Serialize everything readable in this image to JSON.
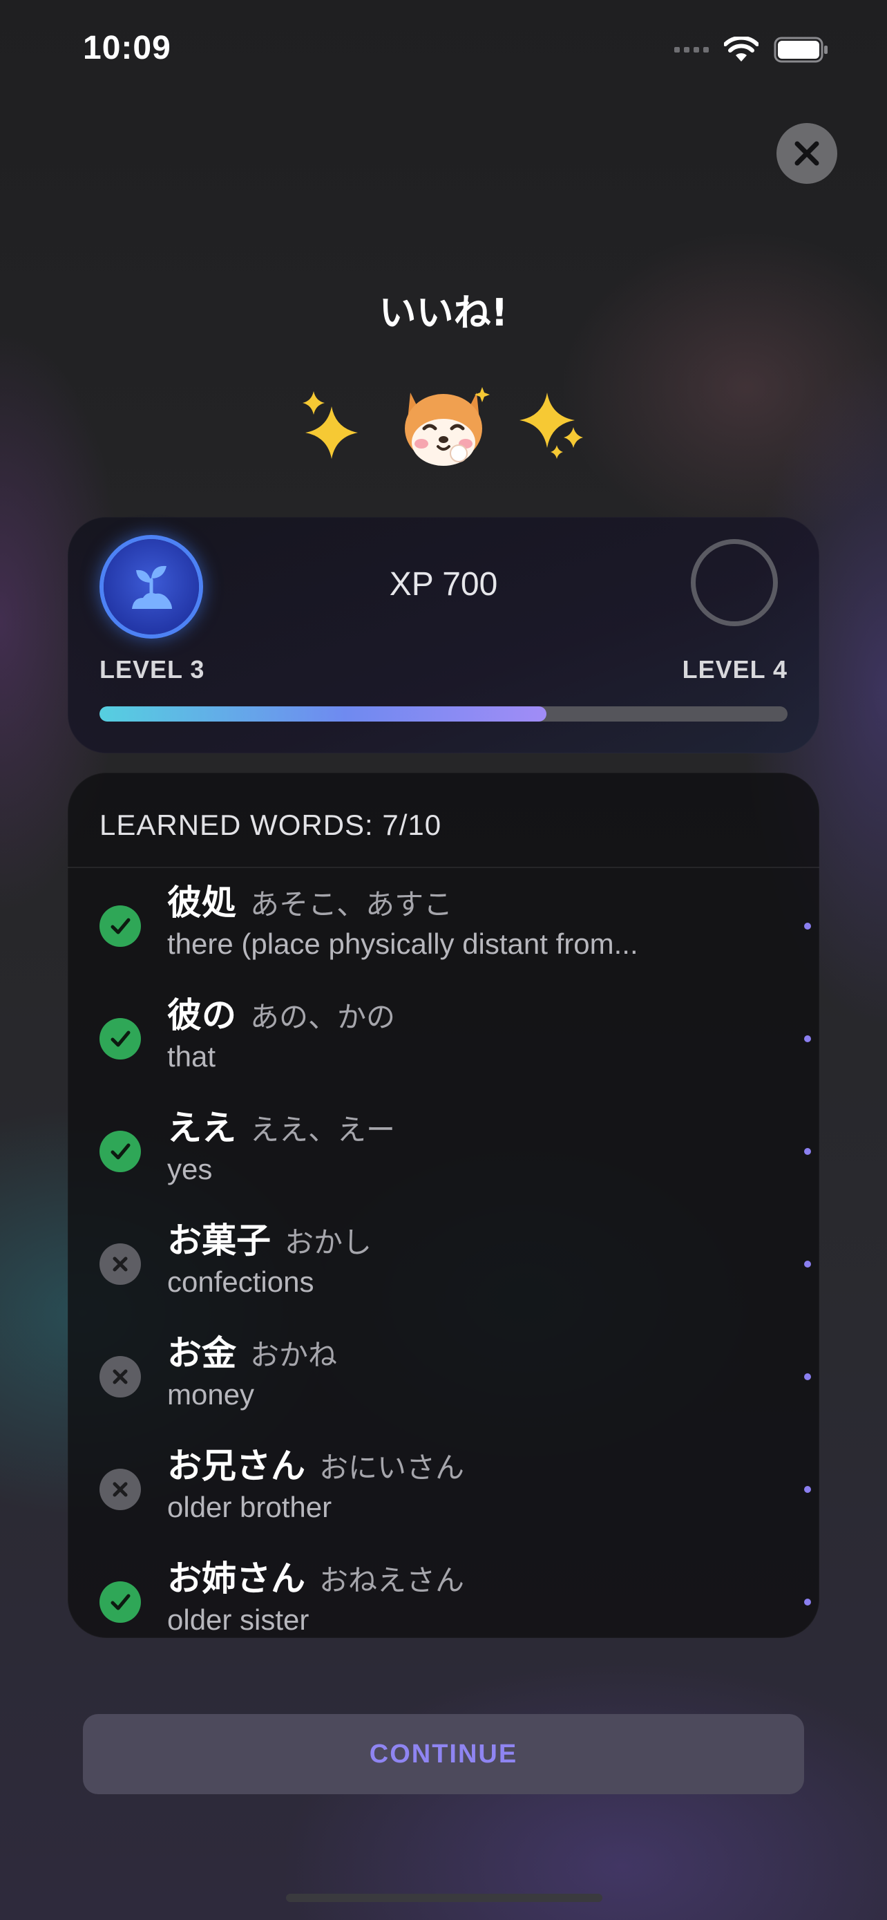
{
  "status_bar": {
    "time": "10:09"
  },
  "title": "いいね!",
  "level_card": {
    "xp_label": "XP 700",
    "current_level": "LEVEL 3",
    "next_level": "LEVEL 4",
    "progress_fraction": 0.65
  },
  "words": {
    "header": "LEARNED WORDS: 7/10",
    "items": [
      {
        "kanji": "彼処",
        "kana": "あそこ、あすこ",
        "meaning": "there (place physically distant from...",
        "learned": true
      },
      {
        "kanji": "彼の",
        "kana": "あの、かの",
        "meaning": "that",
        "learned": true
      },
      {
        "kanji": "ええ",
        "kana": "ええ、えー",
        "meaning": "yes",
        "learned": true
      },
      {
        "kanji": "お菓子",
        "kana": "おかし",
        "meaning": "confections",
        "learned": false
      },
      {
        "kanji": "お金",
        "kana": "おかね",
        "meaning": "money",
        "learned": false
      },
      {
        "kanji": "お兄さん",
        "kana": "おにいさん",
        "meaning": "older brother",
        "learned": false
      },
      {
        "kanji": "お姉さん",
        "kana": "おねえさん",
        "meaning": "older sister",
        "learned": true
      }
    ]
  },
  "continue_label": "CONTINUE",
  "colors": {
    "accent": "#8b7ff0",
    "learned": "#2fa757",
    "not_learned": "#5e5e64"
  }
}
